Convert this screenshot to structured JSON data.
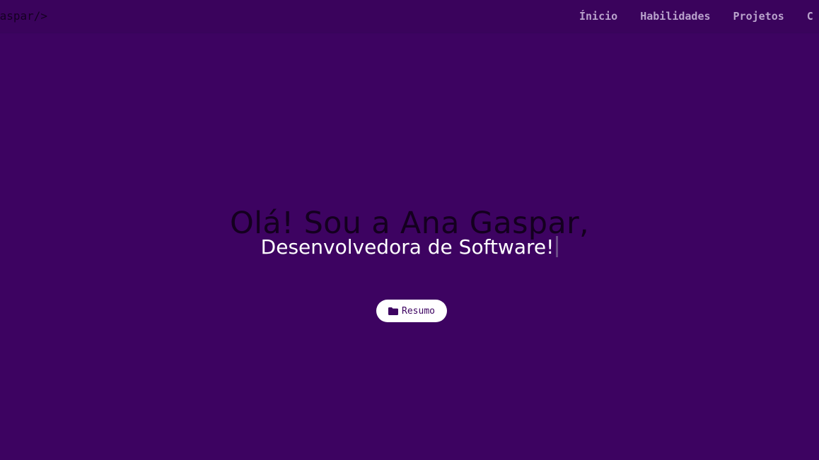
{
  "header": {
    "logo": "gaspar/>",
    "nav": [
      {
        "label": "Ínicio"
      },
      {
        "label": "Habilidades"
      },
      {
        "label": "Projetos"
      },
      {
        "label": "C"
      }
    ]
  },
  "hero": {
    "title": "Olá! Sou a Ana Gaspar,",
    "subtitle": "Desenvolvedora de Software!",
    "resume_button": {
      "label": "Resumo",
      "icon": "folder-icon"
    }
  },
  "colors": {
    "background": "#3d0361",
    "title_text": "#14001f",
    "subtitle_text": "#ffffff",
    "nav_text": "#b9a2cc",
    "button_bg": "#ffffff"
  }
}
